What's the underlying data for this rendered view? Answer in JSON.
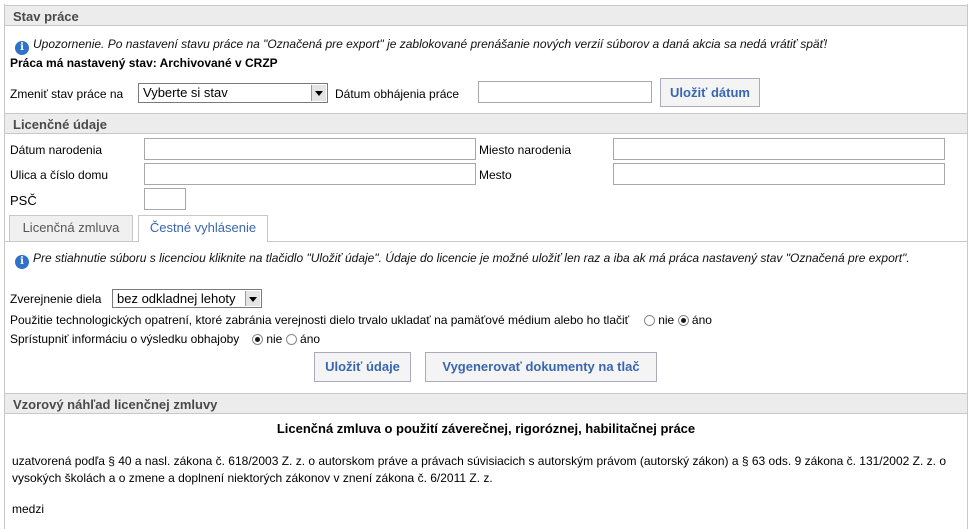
{
  "stav": {
    "title": "Stav práce",
    "warning": "Upozornenie. Po nastavení stavu práce na \"Označená pre export\" je zablokované prenášanie nových verzií súborov a daná akcia sa nedá vrátiť späť!",
    "status_text": "Práca má nastavený stav: Archivované v CRZP",
    "change_label": "Zmeniť stav práce na",
    "select_value": "Vyberte si stav",
    "date_label": "Dátum obhájenia práce",
    "date_value": "",
    "save_date_button": "Uložiť dátum"
  },
  "licencne": {
    "title": "Licenčné údaje",
    "birth_date_label": "Dátum narodenia",
    "birth_place_label": "Miesto narodenia",
    "street_label": "Ulica a číslo domu",
    "city_label": "Mesto",
    "zip_label": "PSČ",
    "tabs": [
      {
        "label": "Licenčná zmluva"
      },
      {
        "label": "Čestné vyhlásenie"
      }
    ],
    "info_text": "Pre stiahnutie súboru s licenciou kliknite na tlačidlo \"Uložiť údaje\". Údaje do licencie je možné uložiť len raz a iba ak má práca nastavený stav \"Označená pre export\".",
    "publish_label": "Zverejnenie diela",
    "publish_value": "bez odkladnej lehoty",
    "tech_label": "Použitie technologických opatrení, ktoré zabránia verejnosti dielo trvalo ukladať na pamäťové médium alebo ho tlačiť",
    "result_label": "Sprístupniť informáciu o výsledku obhajoby",
    "opt_no": "nie",
    "opt_yes": "áno",
    "save_button": "Uložiť údaje",
    "generate_button": "Vygenerovať dokumenty na tlač"
  },
  "nahlad": {
    "title": "Vzorový náhľad licenčnej zmluvy",
    "doc_title": "Licenčná zmluva o použití záverečnej, rigoróznej, habilitačnej práce",
    "paragraph": "uzatvorená podľa § 40 a nasl. zákona č. 618/2003 Z. z. o autorskom práve a právach súvisiacich s autorským právom (autorský zákon) a § 63 ods. 9 zákona č. 131/2002 Z. z. o vysokých školách a o zmene a doplnení niektorých zákonov v znení zákona č. 6/2011 Z. z.",
    "between": "medzi"
  },
  "colors": {
    "accent": "#3a66b0",
    "section_bg": "#ececec",
    "info_icon": "#2f72c8"
  },
  "icons": {
    "info": "info-icon"
  },
  "state": {
    "tech_measures": "áno",
    "result_info": "nie",
    "active_tab": 1
  }
}
